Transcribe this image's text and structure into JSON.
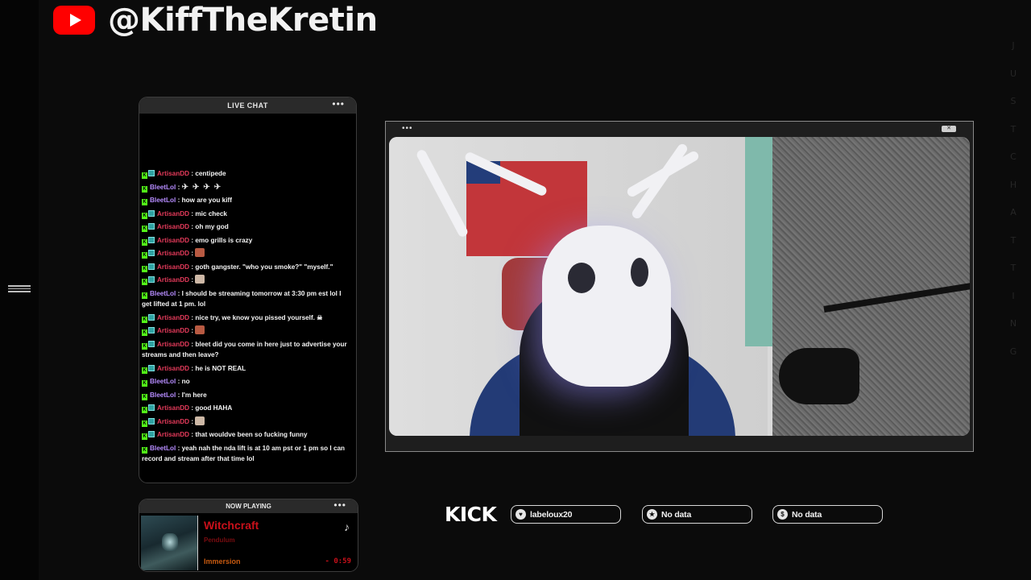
{
  "brand": {
    "handle": "@KiffTheKretin",
    "icon": "youtube-icon",
    "accent": "#ff0000"
  },
  "side_letters": [
    "J",
    "U",
    "S",
    "T",
    "C",
    "H",
    "A",
    "T",
    "T",
    "I",
    "N",
    "G"
  ],
  "chat": {
    "title": "LIVE CHAT",
    "messages": [
      {
        "user": "ArtisanDD",
        "kind": "a",
        "text": "centipede"
      },
      {
        "user": "BleetLol",
        "kind": "b",
        "text": ""
      },
      {
        "user": "BleetLol",
        "kind": "b",
        "text": "how are you kiff"
      },
      {
        "user": "ArtisanDD",
        "kind": "a",
        "text": "mic check"
      },
      {
        "user": "ArtisanDD",
        "kind": "a",
        "text": "oh my god"
      },
      {
        "user": "ArtisanDD",
        "kind": "a",
        "text": "emo grills is crazy"
      },
      {
        "user": "ArtisanDD",
        "kind": "a",
        "text": ""
      },
      {
        "user": "ArtisanDD",
        "kind": "a",
        "text": "goth gangster. \"who you smoke?\" \"myself.\""
      },
      {
        "user": "ArtisanDD",
        "kind": "a",
        "text": ""
      },
      {
        "user": "BleetLol",
        "kind": "b",
        "text": "I should be streaming tomorrow at 3:30 pm est lol I get lifted at 1 pm. lol"
      },
      {
        "user": "ArtisanDD",
        "kind": "a",
        "text": "nice try, we know you pissed yourself."
      },
      {
        "user": "ArtisanDD",
        "kind": "a",
        "text": ""
      },
      {
        "user": "ArtisanDD",
        "kind": "a",
        "text": "bleet did you come in here just to advertise your streams and then leave?"
      },
      {
        "user": "ArtisanDD",
        "kind": "a",
        "text": "he is NOT REAL"
      },
      {
        "user": "BleetLol",
        "kind": "b",
        "text": "no"
      },
      {
        "user": "BleetLol",
        "kind": "b",
        "text": "I'm here"
      },
      {
        "user": "ArtisanDD",
        "kind": "a",
        "text": "good HAHA"
      },
      {
        "user": "ArtisanDD",
        "kind": "a",
        "text": ""
      },
      {
        "user": "ArtisanDD",
        "kind": "a",
        "text": "that wouldve been so fucking funny"
      },
      {
        "user": "BleetLol",
        "kind": "b",
        "text": "yeah nah the nda lift is at 10 am pst or 1 pm so I can record and stream after that time lol"
      }
    ]
  },
  "now_playing": {
    "title": "NOW PLAYING",
    "song": "Witchcraft",
    "artist": "Pendulum",
    "album": "Immersion",
    "time_remaining": "- 0:59"
  },
  "kick": {
    "label": "KICK",
    "stats": [
      {
        "icon": "heart-icon",
        "glyph": "♥",
        "value": "labeloux20"
      },
      {
        "icon": "star-icon",
        "glyph": "★",
        "value": "No data"
      },
      {
        "icon": "dollar-icon",
        "glyph": "$",
        "value": "No data"
      }
    ]
  }
}
